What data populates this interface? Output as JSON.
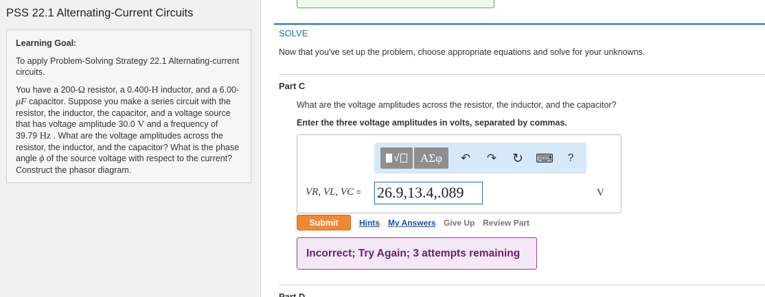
{
  "left": {
    "title": "PSS 22.1 Alternating-Current Circuits",
    "learning_goal_label": "Learning Goal:",
    "learning_goal_text": "To apply Problem-Solving Strategy 22.1 Alternating-current circuits.",
    "problem": {
      "t1": "You have a 200-",
      "ohm": "Ω",
      "t2": " resistor, a 0.400-",
      "henry": "H",
      "t3": " inductor, and a 6.00-",
      "microfarad": "μF",
      "t4": " capacitor. Suppose you make a series circuit with the resistor, the inductor, the capacitor, and a voltage source that has voltage amplitude 30.0 ",
      "volt": "V",
      "t5": " and a frequency of 39.79 ",
      "hz": "Hz",
      "t6": " . What are the voltage amplitudes across the resistor, the inductor, and the capacitor? What is the phase angle ",
      "phi": "ϕ",
      "t7": " of the source voltage with respect to the current? Construct the phasor diagram."
    }
  },
  "solve": {
    "heading": "SOLVE",
    "text": "Now that you've set up the problem, choose appropriate equations and solve for your unknowns."
  },
  "part_c": {
    "label": "Part C",
    "question": "What are the voltage amplitudes across the resistor, the inductor, and the capacitor?",
    "instruction": "Enter the three voltage amplitudes in volts, separated by commas.",
    "toolbar": {
      "templates_glyph": "√",
      "symbols_label": "ΑΣφ",
      "undo_icon": "↶",
      "redo_icon": "↷",
      "reset_icon": "↻",
      "keyboard_icon": "⌨",
      "help_label": "?"
    },
    "equation_label": "VR, VL, VC",
    "equals": "=",
    "answer_value": "26.9,13.4,.089",
    "unit": "V",
    "submit_label": "Submit",
    "links": {
      "hints": "Hints",
      "my_answers": "My Answers",
      "give_up": "Give Up",
      "review_part": "Review Part"
    },
    "feedback": "Incorrect; Try Again; 3 attempts remaining"
  },
  "part_d": {
    "label": "Part D"
  },
  "colors": {
    "accent_blue": "#1a6fb7",
    "submit_orange": "#f08733",
    "feedback_purple": "#6b2070",
    "feedback_bg": "#f5e8f6"
  }
}
